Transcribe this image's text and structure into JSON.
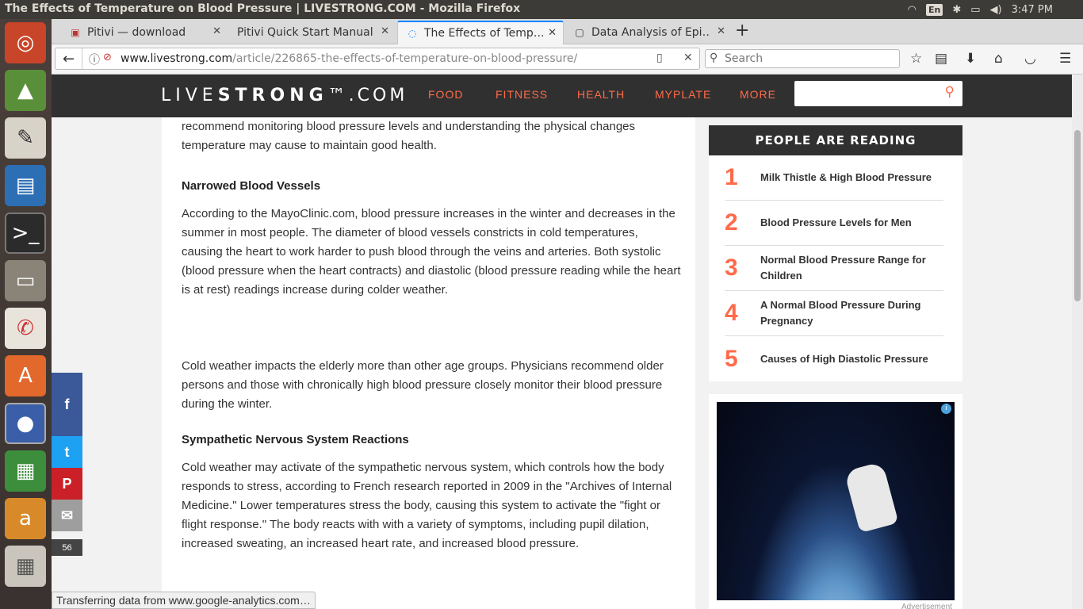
{
  "window_title": "The Effects of Temperature on Blood Pressure | LIVESTRONG.COM - Mozilla Firefox",
  "tray": {
    "lang": "En",
    "time": "3:47 PM"
  },
  "tabs": [
    {
      "label": "Pitivi — download"
    },
    {
      "label": "Pitivi Quick Start Manual"
    },
    {
      "label": "The Effects of Temp…"
    },
    {
      "label": "Data Analysis of Epi…"
    }
  ],
  "url": {
    "domain": "www.livestrong.com",
    "path": "/article/226865-the-effects-of-temperature-on-blood-pressure/"
  },
  "search_placeholder": "Search",
  "site": {
    "logo_light1": "LIVE",
    "logo_bold": "STRONG",
    "logo_light2": "™.COM",
    "nav": [
      "FOOD",
      "FITNESS",
      "HEALTH",
      "MYPLATE",
      "MORE"
    ],
    "accent": "#ff6b4a"
  },
  "article": {
    "p0": "recommend monitoring blood pressure levels and understanding the physical changes temperature may cause to maintain good health.",
    "h1": "Narrowed Blood Vessels",
    "p1": "According to the MayoClinic.com, blood pressure increases in the winter and decreases in the summer in most people. The diameter of blood vessels constricts in cold temperatures, causing the heart to work harder to push blood through the veins and arteries. Both systolic (blood pressure when the heart contracts) and diastolic (blood pressure reading while the heart is at rest) readings increase during colder weather.",
    "p2": "Cold weather impacts the elderly more than other age groups. Physicians recommend older persons and those with chronically high blood pressure closely monitor their blood pressure during the winter.",
    "h2": "Sympathetic Nervous System Reactions",
    "p3": "Cold weather may activate of the sympathetic nervous system, which controls how the body responds to stress, according to French research reported in 2009 in the \"Archives of Internal Medicine.\" Lower temperatures stress the body, causing this system to activate the \"fight or flight response.\" The body reacts with with a variety of symptoms, including pupil dilation, increased sweating, an increased heart rate, and increased blood pressure."
  },
  "sidebar": {
    "heading": "PEOPLE ARE READING",
    "items": [
      {
        "num": "1",
        "title": "Milk Thistle & High Blood Pressure"
      },
      {
        "num": "2",
        "title": "Blood Pressure Levels for Men"
      },
      {
        "num": "3",
        "title": "Normal Blood Pressure Range for Children"
      },
      {
        "num": "4",
        "title": "A Normal Blood Pressure During Pregnancy"
      },
      {
        "num": "5",
        "title": "Causes of High Diastolic Pressure"
      }
    ],
    "ad_label": "Advertisement"
  },
  "share": {
    "facebook": "f",
    "twitter": "t",
    "pinterest": "P",
    "email": "✉",
    "count": "56"
  },
  "status": "Transferring data from www.google-analytics.com…"
}
